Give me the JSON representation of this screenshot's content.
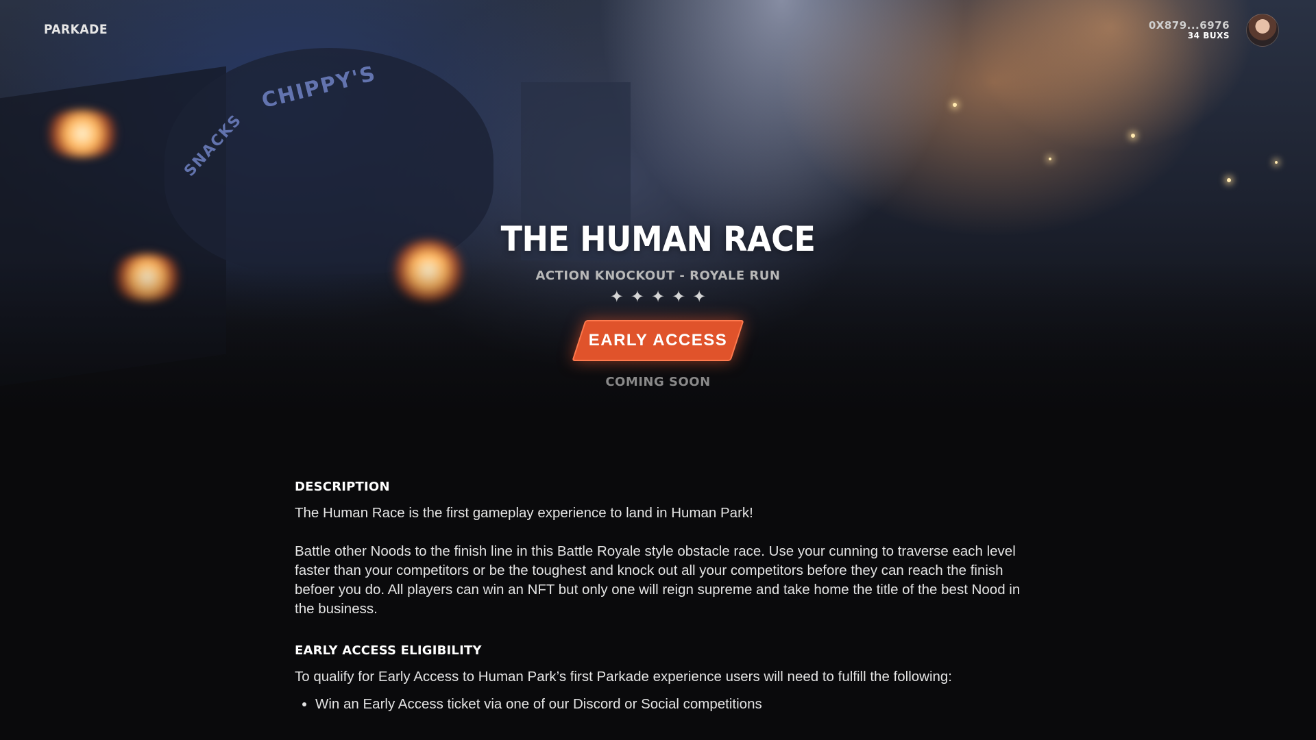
{
  "header": {
    "brand": "PARKADE",
    "wallet": "0X879...6976",
    "balance": "34 BUXS"
  },
  "hero": {
    "title": "THE HUMAN RACE",
    "genre_primary": "ACTION KNOCKOUT -",
    "genre_secondary": "ROYALE RUN",
    "rating": {
      "stars": 5,
      "max": 5
    },
    "cta_label": "EARLY ACCESS",
    "status": "COMING SOON",
    "accent_color": "#e0532b"
  },
  "description": {
    "heading": "DESCRIPTION",
    "p1": "The Human Race is the first gameplay experience to land in Human Park!",
    "p2": "Battle other Noods to the finish line in this Battle Royale style obstacle race. Use your cunning to traverse each level faster than your competitors or be the toughest and knock out all your competitors before they can reach the finish befoer you do. All players can win an NFT but only one will reign supreme and take home the title of the best Nood in the business."
  },
  "eligibility": {
    "heading": "EARLY ACCESS ELIGIBILITY",
    "intro": "To qualify for Early Access to Human Park’s first Parkade experience users will need to fulfill the following:",
    "items": [
      "Win an Early Access ticket via one of our Discord or Social competitions"
    ]
  },
  "icons": {
    "star": "star-icon",
    "avatar": "user-avatar"
  }
}
